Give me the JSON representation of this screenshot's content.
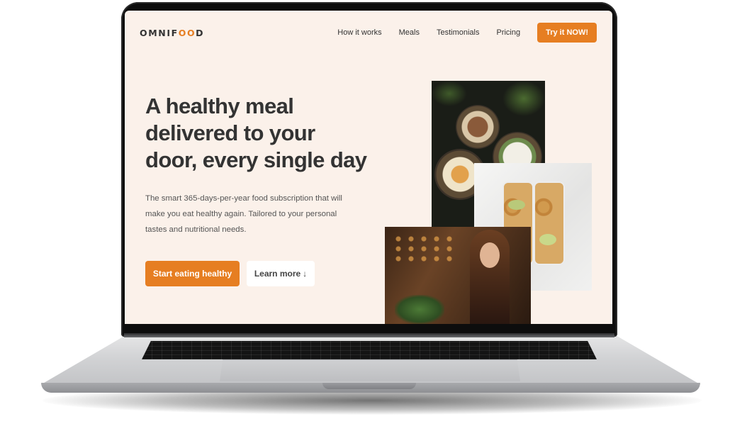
{
  "site": {
    "logo_prefix": "OMNIF",
    "logo_oo": "OO",
    "logo_suffix": "D"
  },
  "nav": {
    "links": [
      "How it works",
      "Meals",
      "Testimonials",
      "Pricing"
    ],
    "cta": "Try it NOW!"
  },
  "hero": {
    "title": "A healthy meal delivered to your door, every single day",
    "description": "The smart 365-days-per-year food subscription that will make you eat healthy again. Tailored to your personal tastes and nutritional needs.",
    "primary_button": "Start eating healthy",
    "secondary_button": "Learn more",
    "secondary_arrow": "↓"
  },
  "colors": {
    "accent": "#e67e22",
    "background": "#fbf1ea",
    "text": "#333333"
  }
}
